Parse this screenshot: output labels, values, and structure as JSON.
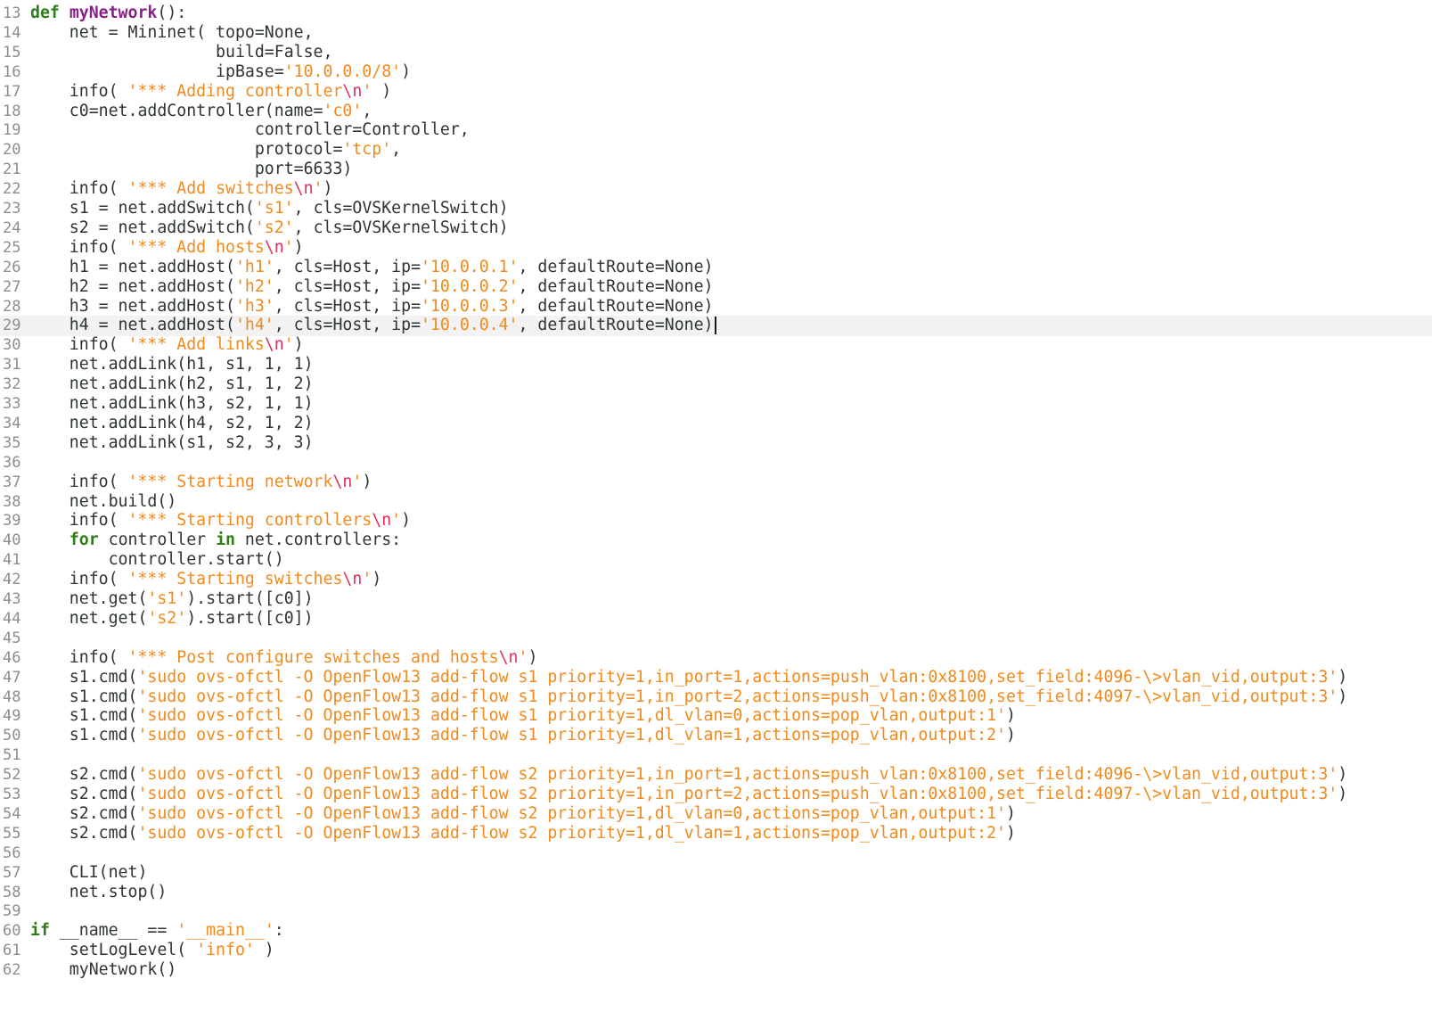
{
  "editor": {
    "cursor_line": 29,
    "lines": [
      {
        "n": "13",
        "t": [
          [
            "kw",
            "def"
          ],
          [
            "p",
            " "
          ],
          [
            "fn",
            "myNetwork"
          ],
          [
            "p",
            "():"
          ]
        ]
      },
      {
        "n": "14",
        "t": [
          [
            "p",
            "    net = Mininet( topo=None,"
          ]
        ]
      },
      {
        "n": "15",
        "t": [
          [
            "p",
            "                   build=False,"
          ]
        ]
      },
      {
        "n": "16",
        "t": [
          [
            "p",
            "                   ipBase="
          ],
          [
            "str",
            "'10.0.0.0/8'"
          ],
          [
            "p",
            ")"
          ]
        ]
      },
      {
        "n": "17",
        "t": [
          [
            "p",
            "    info( "
          ],
          [
            "str",
            "'*** Adding controller"
          ],
          [
            "esc",
            "\\n"
          ],
          [
            "str",
            "'"
          ],
          [
            "p",
            " )"
          ]
        ]
      },
      {
        "n": "18",
        "t": [
          [
            "p",
            "    c0=net.addController(name="
          ],
          [
            "str",
            "'c0'"
          ],
          [
            "p",
            ","
          ]
        ]
      },
      {
        "n": "19",
        "t": [
          [
            "p",
            "                       controller=Controller,"
          ]
        ]
      },
      {
        "n": "20",
        "t": [
          [
            "p",
            "                       protocol="
          ],
          [
            "str",
            "'tcp'"
          ],
          [
            "p",
            ","
          ]
        ]
      },
      {
        "n": "21",
        "t": [
          [
            "p",
            "                       port=6633)"
          ]
        ]
      },
      {
        "n": "22",
        "t": [
          [
            "p",
            "    info( "
          ],
          [
            "str",
            "'*** Add switches"
          ],
          [
            "esc",
            "\\n"
          ],
          [
            "str",
            "'"
          ],
          [
            "p",
            ")"
          ]
        ]
      },
      {
        "n": "23",
        "t": [
          [
            "p",
            "    s1 = net.addSwitch("
          ],
          [
            "str",
            "'s1'"
          ],
          [
            "p",
            ", cls=OVSKernelSwitch)"
          ]
        ]
      },
      {
        "n": "24",
        "t": [
          [
            "p",
            "    s2 = net.addSwitch("
          ],
          [
            "str",
            "'s2'"
          ],
          [
            "p",
            ", cls=OVSKernelSwitch)"
          ]
        ]
      },
      {
        "n": "25",
        "t": [
          [
            "p",
            "    info( "
          ],
          [
            "str",
            "'*** Add hosts"
          ],
          [
            "esc",
            "\\n"
          ],
          [
            "str",
            "'"
          ],
          [
            "p",
            ")"
          ]
        ]
      },
      {
        "n": "26",
        "t": [
          [
            "p",
            "    h1 = net.addHost("
          ],
          [
            "str",
            "'h1'"
          ],
          [
            "p",
            ", cls=Host, ip="
          ],
          [
            "str",
            "'10.0.0.1'"
          ],
          [
            "p",
            ", defaultRoute=None)"
          ]
        ]
      },
      {
        "n": "27",
        "t": [
          [
            "p",
            "    h2 = net.addHost("
          ],
          [
            "str",
            "'h2'"
          ],
          [
            "p",
            ", cls=Host, ip="
          ],
          [
            "str",
            "'10.0.0.2'"
          ],
          [
            "p",
            ", defaultRoute=None)"
          ]
        ]
      },
      {
        "n": "28",
        "t": [
          [
            "p",
            "    h3 = net.addHost("
          ],
          [
            "str",
            "'h3'"
          ],
          [
            "p",
            ", cls=Host, ip="
          ],
          [
            "str",
            "'10.0.0.3'"
          ],
          [
            "p",
            ", defaultRoute=None)"
          ]
        ]
      },
      {
        "n": "29",
        "t": [
          [
            "p",
            "    h4 = net.addHost("
          ],
          [
            "str",
            "'h4'"
          ],
          [
            "p",
            ", cls=Host, ip="
          ],
          [
            "str",
            "'10.0.0.4'"
          ],
          [
            "p",
            ", defaultRoute=None)"
          ]
        ]
      },
      {
        "n": "30",
        "t": [
          [
            "p",
            "    info( "
          ],
          [
            "str",
            "'*** Add links"
          ],
          [
            "esc",
            "\\n"
          ],
          [
            "str",
            "'"
          ],
          [
            "p",
            ")"
          ]
        ]
      },
      {
        "n": "31",
        "t": [
          [
            "p",
            "    net.addLink(h1, s1, 1, 1)"
          ]
        ]
      },
      {
        "n": "32",
        "t": [
          [
            "p",
            "    net.addLink(h2, s1, 1, 2)"
          ]
        ]
      },
      {
        "n": "33",
        "t": [
          [
            "p",
            "    net.addLink(h3, s2, 1, 1)"
          ]
        ]
      },
      {
        "n": "34",
        "t": [
          [
            "p",
            "    net.addLink(h4, s2, 1, 2)"
          ]
        ]
      },
      {
        "n": "35",
        "t": [
          [
            "p",
            "    net.addLink(s1, s2, 3, 3)"
          ]
        ]
      },
      {
        "n": "36",
        "t": []
      },
      {
        "n": "37",
        "t": [
          [
            "p",
            "    info( "
          ],
          [
            "str",
            "'*** Starting network"
          ],
          [
            "esc",
            "\\n"
          ],
          [
            "str",
            "'"
          ],
          [
            "p",
            ")"
          ]
        ]
      },
      {
        "n": "38",
        "t": [
          [
            "p",
            "    net.build()"
          ]
        ]
      },
      {
        "n": "39",
        "t": [
          [
            "p",
            "    info( "
          ],
          [
            "str",
            "'*** Starting controllers"
          ],
          [
            "esc",
            "\\n"
          ],
          [
            "str",
            "'"
          ],
          [
            "p",
            ")"
          ]
        ]
      },
      {
        "n": "40",
        "t": [
          [
            "p",
            "    "
          ],
          [
            "kw",
            "for"
          ],
          [
            "p",
            " controller "
          ],
          [
            "kw",
            "in"
          ],
          [
            "p",
            " net.controllers:"
          ]
        ]
      },
      {
        "n": "41",
        "t": [
          [
            "p",
            "        controller.start()"
          ]
        ]
      },
      {
        "n": "42",
        "t": [
          [
            "p",
            "    info( "
          ],
          [
            "str",
            "'*** Starting switches"
          ],
          [
            "esc",
            "\\n"
          ],
          [
            "str",
            "'"
          ],
          [
            "p",
            ")"
          ]
        ]
      },
      {
        "n": "43",
        "t": [
          [
            "p",
            "    net.get("
          ],
          [
            "str",
            "'s1'"
          ],
          [
            "p",
            ").start([c0])"
          ]
        ]
      },
      {
        "n": "44",
        "t": [
          [
            "p",
            "    net.get("
          ],
          [
            "str",
            "'s2'"
          ],
          [
            "p",
            ").start([c0])"
          ]
        ]
      },
      {
        "n": "45",
        "t": []
      },
      {
        "n": "46",
        "t": [
          [
            "p",
            "    info( "
          ],
          [
            "str",
            "'*** Post configure switches and hosts"
          ],
          [
            "esc",
            "\\n"
          ],
          [
            "str",
            "'"
          ],
          [
            "p",
            ")"
          ]
        ]
      },
      {
        "n": "47",
        "t": [
          [
            "p",
            "    s1.cmd("
          ],
          [
            "str",
            "'sudo ovs-ofctl -O OpenFlow13 add-flow s1 priority=1,in_port=1,actions=push_vlan:0x8100,set_field:4096-\\>vlan_vid,output:3'"
          ],
          [
            "p",
            ")"
          ]
        ]
      },
      {
        "n": "48",
        "t": [
          [
            "p",
            "    s1.cmd("
          ],
          [
            "str",
            "'sudo ovs-ofctl -O OpenFlow13 add-flow s1 priority=1,in_port=2,actions=push_vlan:0x8100,set_field:4097-\\>vlan_vid,output:3'"
          ],
          [
            "p",
            ")"
          ]
        ]
      },
      {
        "n": "49",
        "t": [
          [
            "p",
            "    s1.cmd("
          ],
          [
            "str",
            "'sudo ovs-ofctl -O OpenFlow13 add-flow s1 priority=1,dl_vlan=0,actions=pop_vlan,output:1'"
          ],
          [
            "p",
            ")"
          ]
        ]
      },
      {
        "n": "50",
        "t": [
          [
            "p",
            "    s1.cmd("
          ],
          [
            "str",
            "'sudo ovs-ofctl -O OpenFlow13 add-flow s1 priority=1,dl_vlan=1,actions=pop_vlan,output:2'"
          ],
          [
            "p",
            ")"
          ]
        ]
      },
      {
        "n": "51",
        "t": []
      },
      {
        "n": "52",
        "t": [
          [
            "p",
            "    s2.cmd("
          ],
          [
            "str",
            "'sudo ovs-ofctl -O OpenFlow13 add-flow s2 priority=1,in_port=1,actions=push_vlan:0x8100,set_field:4096-\\>vlan_vid,output:3'"
          ],
          [
            "p",
            ")"
          ]
        ]
      },
      {
        "n": "53",
        "t": [
          [
            "p",
            "    s2.cmd("
          ],
          [
            "str",
            "'sudo ovs-ofctl -O OpenFlow13 add-flow s2 priority=1,in_port=2,actions=push_vlan:0x8100,set_field:4097-\\>vlan_vid,output:3'"
          ],
          [
            "p",
            ")"
          ]
        ]
      },
      {
        "n": "54",
        "t": [
          [
            "p",
            "    s2.cmd("
          ],
          [
            "str",
            "'sudo ovs-ofctl -O OpenFlow13 add-flow s2 priority=1,dl_vlan=0,actions=pop_vlan,output:1'"
          ],
          [
            "p",
            ")"
          ]
        ]
      },
      {
        "n": "55",
        "t": [
          [
            "p",
            "    s2.cmd("
          ],
          [
            "str",
            "'sudo ovs-ofctl -O OpenFlow13 add-flow s2 priority=1,dl_vlan=1,actions=pop_vlan,output:2'"
          ],
          [
            "p",
            ")"
          ]
        ]
      },
      {
        "n": "56",
        "t": []
      },
      {
        "n": "57",
        "t": [
          [
            "p",
            "    CLI(net)"
          ]
        ]
      },
      {
        "n": "58",
        "t": [
          [
            "p",
            "    net.stop()"
          ]
        ]
      },
      {
        "n": "59",
        "t": []
      },
      {
        "n": "60",
        "t": [
          [
            "kw",
            "if"
          ],
          [
            "p",
            " __name__ == "
          ],
          [
            "str",
            "'__main__'"
          ],
          [
            "p",
            ":"
          ]
        ]
      },
      {
        "n": "61",
        "t": [
          [
            "p",
            "    setLogLevel( "
          ],
          [
            "str",
            "'info'"
          ],
          [
            "p",
            " )"
          ]
        ]
      },
      {
        "n": "62",
        "t": [
          [
            "p",
            "    myNetwork()"
          ]
        ]
      }
    ]
  }
}
